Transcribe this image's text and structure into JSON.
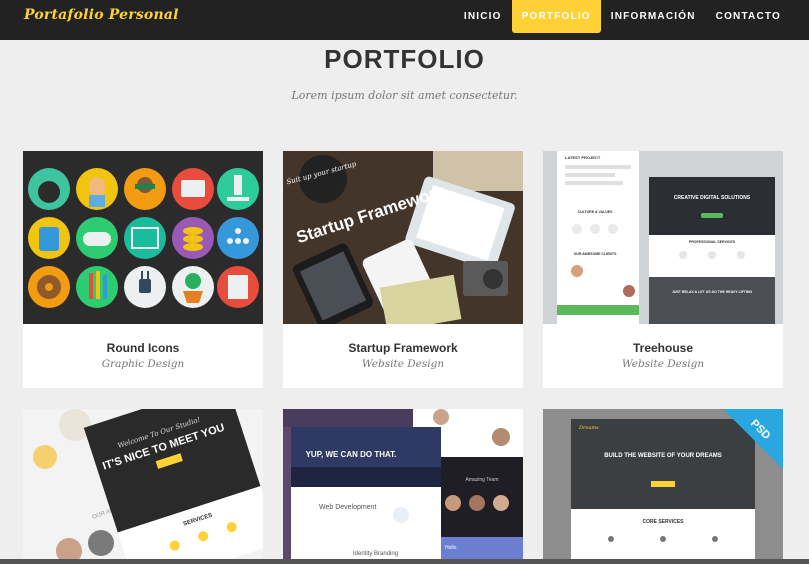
{
  "brand": "Portafolio Personal",
  "nav": {
    "items": [
      {
        "label": "INICIO",
        "active": false
      },
      {
        "label": "PORTFOLIO",
        "active": true
      },
      {
        "label": "INFORMACIÓN",
        "active": false
      },
      {
        "label": "CONTACTO",
        "active": false
      }
    ]
  },
  "colors": {
    "accent": "#fed136",
    "navbar": "#222222",
    "background": "#eeeeee"
  },
  "section": {
    "title": "PORTFOLIO",
    "subtitle": "Lorem ipsum dolor sit amet consectetur."
  },
  "portfolio": {
    "items": [
      {
        "title": "Round Icons",
        "category": "Graphic Design"
      },
      {
        "title": "Startup Framework",
        "category": "Website Design"
      },
      {
        "title": "Treehouse",
        "category": "Website Design"
      },
      {
        "title": "",
        "category": ""
      },
      {
        "title": "",
        "category": ""
      },
      {
        "title": "",
        "category": ""
      }
    ],
    "thumbs": {
      "startup": {
        "headline": "Startup Framework",
        "badge": "Suit up your startup"
      },
      "treehouse": {
        "label": "LATEST PROJECT",
        "headline": "CREATIVE DIGITAL SOLUTIONS",
        "services": "PROFESSIONAL SERVICES",
        "features": "CULTURE & VALUES",
        "clients": "OUR AWESOME CLIENTS",
        "relax": "JUST RELAX & LET US DO THE HEAVY LIFTING"
      },
      "golden": {
        "welcome": "Welcome To Our Studio!",
        "headline": "IT'S NICE TO MEET YOU",
        "services": "SERVICES",
        "about": "OUR AMAZING"
      },
      "yup": {
        "headline": "YUP, WE CAN DO THAT.",
        "web": "Web Development",
        "identity": "Identity Branding",
        "team": "Amazing Team",
        "hello": "Hello"
      },
      "dreams": {
        "badge": "PSD",
        "brand": "Dreams",
        "headline": "BUILD THE WEBSITE OF YOUR DREAMS",
        "services": "CORE SERVICES"
      }
    }
  }
}
